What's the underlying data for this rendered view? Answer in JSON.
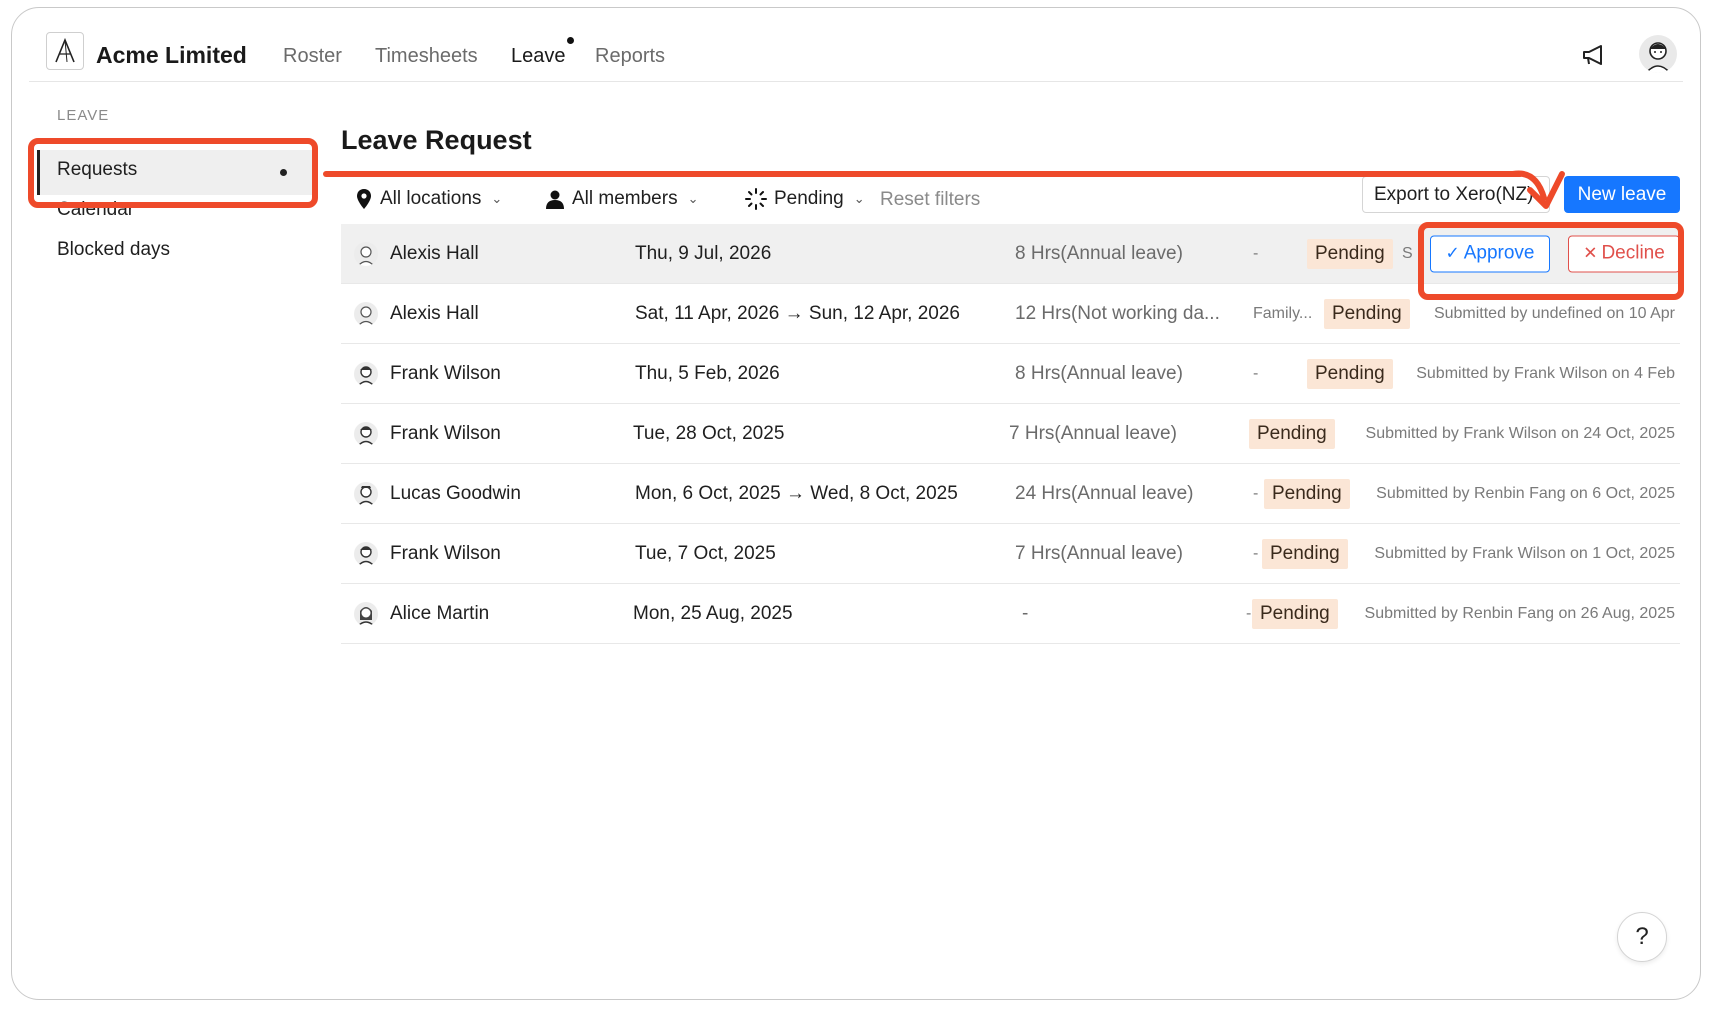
{
  "app": {
    "org_name": "Acme Limited"
  },
  "nav": {
    "items": [
      "Roster",
      "Timesheets",
      "Leave",
      "Reports"
    ],
    "active": "Leave"
  },
  "sidebar": {
    "section": "LEAVE",
    "items": [
      "Requests",
      "Calendar",
      "Blocked days"
    ],
    "active": "Requests"
  },
  "main": {
    "title": "Leave Request",
    "filters": {
      "locations": "All locations",
      "members": "All members",
      "status": "Pending",
      "reset": "Reset filters"
    },
    "export_label": "Export to Xero(NZ)",
    "new_label": "New leave"
  },
  "actions": {
    "approve": "Approve",
    "decline": "Decline"
  },
  "rows": [
    {
      "name": "Alexis Hall",
      "date": "Thu, 9 Jul, 2026",
      "hours": "8 Hrs(Annual leave)",
      "note": "-",
      "status": "Pending",
      "submitted": "S"
    },
    {
      "name": "Alexis Hall",
      "date": "Sat, 11 Apr, 2026 → Sun, 12 Apr, 2026",
      "hours": "12 Hrs(Not working da...",
      "note": "Family...",
      "status": "Pending",
      "submitted": "Submitted by undefined on 10 Apr"
    },
    {
      "name": "Frank Wilson",
      "date": "Thu, 5 Feb, 2026",
      "hours": "8 Hrs(Annual leave)",
      "note": "-",
      "status": "Pending",
      "submitted": "Submitted by Frank Wilson on 4 Feb"
    },
    {
      "name": "Frank Wilson",
      "date": "Tue, 28 Oct, 2025",
      "hours": "7 Hrs(Annual leave)",
      "note": "",
      "status": "Pending",
      "submitted": "Submitted by Frank Wilson on 24 Oct, 2025"
    },
    {
      "name": "Lucas Goodwin",
      "date": "Mon, 6 Oct, 2025 → Wed, 8 Oct, 2025",
      "hours": "24 Hrs(Annual leave)",
      "note": "-",
      "status": "Pending",
      "submitted": "Submitted by Renbin Fang on 6 Oct, 2025"
    },
    {
      "name": "Frank Wilson",
      "date": "Tue, 7 Oct, 2025",
      "hours": "7 Hrs(Annual leave)",
      "note": "-",
      "status": "Pending",
      "submitted": "Submitted by Frank Wilson on 1 Oct, 2025"
    },
    {
      "name": "Alice Martin",
      "date": "Mon, 25 Aug, 2025",
      "hours": "-",
      "note": "-",
      "status": "Pending",
      "submitted": "Submitted by Renbin Fang on 26 Aug, 2025"
    }
  ],
  "help_label": "?",
  "colors": {
    "primary": "#1677ff",
    "danger": "#e0504b",
    "annotation": "#ee4a2a",
    "pending_bg": "#fbe6d6"
  }
}
